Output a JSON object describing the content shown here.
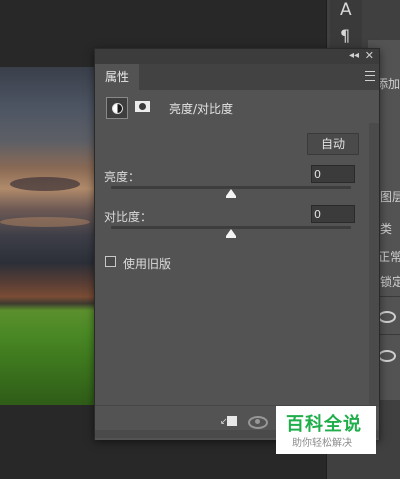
{
  "panel": {
    "tab_label": "属性",
    "adjustment_title": "亮度/对比度",
    "auto_button": "自动",
    "brightness": {
      "label": "亮度：",
      "value": "0",
      "slider_fraction": 0.5
    },
    "contrast": {
      "label": "对比度：",
      "value": "0",
      "slider_fraction": 0.5
    },
    "legacy": {
      "label": "使用旧版",
      "checked": false
    },
    "collapse_glyph": "◂◂",
    "close_glyph": "✕"
  },
  "right_panel": {
    "tool_a": "A",
    "tool_para": "¶",
    "close_glyph": "✕",
    "add_text": "添加",
    "layers_text": "图层",
    "kind_text": "类",
    "normal_text": "正常",
    "lock_text": "锁定"
  },
  "watermark": {
    "title": "百科全说",
    "subtitle": "助你轻松解决"
  },
  "icons": [
    "brightness-contrast-icon",
    "mask-icon",
    "panel-menu-icon",
    "clip-to-layer-icon",
    "view-previous-icon",
    "visibility-eye-icon"
  ]
}
